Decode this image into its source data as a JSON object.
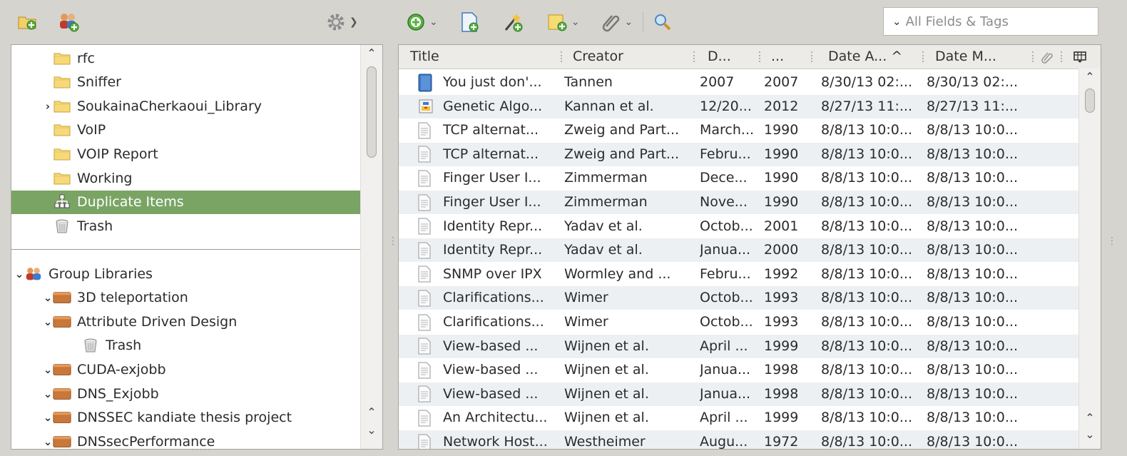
{
  "search": {
    "placeholder": "All Fields & Tags"
  },
  "collections": [
    {
      "label": "rfc",
      "icon": "folder-icon",
      "indent": 1,
      "twisty": ""
    },
    {
      "label": "Sniffer",
      "icon": "folder-icon",
      "indent": 1,
      "twisty": ""
    },
    {
      "label": "SoukainaCherkaoui_Library",
      "icon": "folder-icon",
      "indent": 1,
      "twisty": ">"
    },
    {
      "label": "VoIP",
      "icon": "folder-icon",
      "indent": 1,
      "twisty": ""
    },
    {
      "label": "VOIP Report",
      "icon": "folder-icon",
      "indent": 1,
      "twisty": ""
    },
    {
      "label": "Working",
      "icon": "folder-icon",
      "indent": 1,
      "twisty": ""
    },
    {
      "label": "Duplicate Items",
      "icon": "duplicate-items-icon",
      "indent": 1,
      "twisty": "",
      "selected": true
    },
    {
      "label": "Trash",
      "icon": "trash-icon",
      "indent": 1,
      "twisty": ""
    }
  ],
  "groups": [
    {
      "label": "Group Libraries",
      "icon": "group-libraries-icon",
      "indent": 0,
      "twisty": "v"
    },
    {
      "label": "3D teleportation",
      "icon": "library-icon",
      "indent": 1,
      "twisty": "v"
    },
    {
      "label": "Attribute Driven Design",
      "icon": "library-icon",
      "indent": 1,
      "twisty": "v"
    },
    {
      "label": "Trash",
      "icon": "trash-icon",
      "indent": 2,
      "twisty": ""
    },
    {
      "label": "CUDA-exjobb",
      "icon": "library-icon",
      "indent": 1,
      "twisty": "v"
    },
    {
      "label": "DNS_Exjobb",
      "icon": "library-icon",
      "indent": 1,
      "twisty": "v"
    },
    {
      "label": "DNSSEC kandiate thesis project",
      "icon": "library-icon",
      "indent": 1,
      "twisty": "v"
    },
    {
      "label": "DNSsecPerformance",
      "icon": "library-icon",
      "indent": 1,
      "twisty": "v"
    }
  ],
  "columns": [
    {
      "label": "Title"
    },
    {
      "label": "Creator"
    },
    {
      "label": "D..."
    },
    {
      "label": "..."
    },
    {
      "label": "Date A... ^"
    },
    {
      "label": "Date M..."
    }
  ],
  "items": [
    {
      "icon": "book-icon",
      "title": "You just don'...",
      "creator": "Tannen",
      "date": "2007",
      "year": "2007",
      "added": "8/30/13 02:...",
      "modified": "8/30/13 02:..."
    },
    {
      "icon": "computer-program-icon",
      "title": "Genetic Algo...",
      "creator": "Kannan et al.",
      "date": "12/20...",
      "year": "2012",
      "added": "8/27/13 11:...",
      "modified": "8/27/13 11:..."
    },
    {
      "icon": "report-icon",
      "title": "TCP alternat...",
      "creator": "Zweig and Part...",
      "date": "March...",
      "year": "1990",
      "added": "8/8/13 10:0...",
      "modified": "8/8/13 10:0..."
    },
    {
      "icon": "report-icon",
      "title": "TCP alternat...",
      "creator": "Zweig and Part...",
      "date": "Febru...",
      "year": "1990",
      "added": "8/8/13 10:0...",
      "modified": "8/8/13 10:0..."
    },
    {
      "icon": "report-icon",
      "title": "Finger User I...",
      "creator": "Zimmerman",
      "date": "Dece...",
      "year": "1990",
      "added": "8/8/13 10:0...",
      "modified": "8/8/13 10:0..."
    },
    {
      "icon": "report-icon",
      "title": "Finger User I...",
      "creator": "Zimmerman",
      "date": "Nove...",
      "year": "1990",
      "added": "8/8/13 10:0...",
      "modified": "8/8/13 10:0..."
    },
    {
      "icon": "report-icon",
      "title": "Identity Repr...",
      "creator": "Yadav et al.",
      "date": "Octob...",
      "year": "2001",
      "added": "8/8/13 10:0...",
      "modified": "8/8/13 10:0..."
    },
    {
      "icon": "report-icon",
      "title": "Identity Repr...",
      "creator": "Yadav et al.",
      "date": "Janua...",
      "year": "2000",
      "added": "8/8/13 10:0...",
      "modified": "8/8/13 10:0..."
    },
    {
      "icon": "report-icon",
      "title": "SNMP over IPX",
      "creator": "Wormley and ...",
      "date": "Febru...",
      "year": "1992",
      "added": "8/8/13 10:0...",
      "modified": "8/8/13 10:0..."
    },
    {
      "icon": "report-icon",
      "title": "Clarifications...",
      "creator": "Wimer",
      "date": "Octob...",
      "year": "1993",
      "added": "8/8/13 10:0...",
      "modified": "8/8/13 10:0..."
    },
    {
      "icon": "report-icon",
      "title": "Clarifications...",
      "creator": "Wimer",
      "date": "Octob...",
      "year": "1993",
      "added": "8/8/13 10:0...",
      "modified": "8/8/13 10:0..."
    },
    {
      "icon": "report-icon",
      "title": "View-based ...",
      "creator": "Wijnen et al.",
      "date": "April ...",
      "year": "1999",
      "added": "8/8/13 10:0...",
      "modified": "8/8/13 10:0..."
    },
    {
      "icon": "report-icon",
      "title": "View-based ...",
      "creator": "Wijnen et al.",
      "date": "Janua...",
      "year": "1998",
      "added": "8/8/13 10:0...",
      "modified": "8/8/13 10:0..."
    },
    {
      "icon": "report-icon",
      "title": "View-based ...",
      "creator": "Wijnen et al.",
      "date": "Janua...",
      "year": "1998",
      "added": "8/8/13 10:0...",
      "modified": "8/8/13 10:0..."
    },
    {
      "icon": "report-icon",
      "title": "An Architectu...",
      "creator": "Wijnen et al.",
      "date": "April ...",
      "year": "1999",
      "added": "8/8/13 10:0...",
      "modified": "8/8/13 10:0..."
    },
    {
      "icon": "report-icon",
      "title": "Network Host...",
      "creator": "Westheimer",
      "date": "Augu...",
      "year": "1972",
      "added": "8/8/13 10:0...",
      "modified": "8/8/13 10:0..."
    }
  ]
}
